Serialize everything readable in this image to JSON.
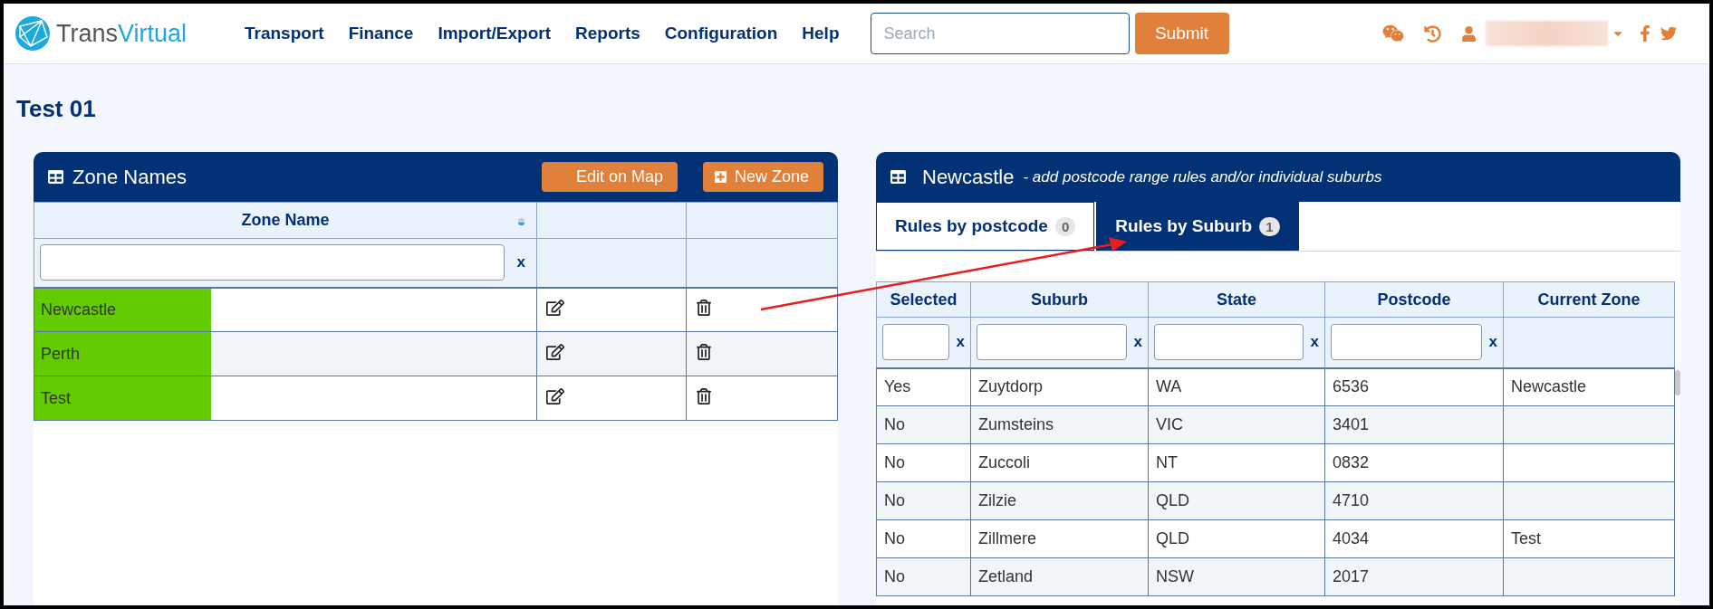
{
  "logo": {
    "brand_a": "Trans",
    "brand_b": "Virtual"
  },
  "nav": [
    "Transport",
    "Finance",
    "Import/Export",
    "Reports",
    "Configuration",
    "Help"
  ],
  "search": {
    "placeholder": "Search"
  },
  "submit": "Submit",
  "page_title": "Test 01",
  "zones_panel": {
    "title": "Zone Names",
    "buttons": [
      {
        "label": "Edit on Map",
        "kind": "plain"
      },
      {
        "label": "New Zone",
        "kind": "add"
      }
    ],
    "column": "Zone Name",
    "filter_clear": "x",
    "rows": [
      {
        "name": "Newcastle",
        "highlighted": true
      },
      {
        "name": "Perth",
        "highlighted": true
      },
      {
        "name": "Test",
        "highlighted": true
      }
    ]
  },
  "rules_panel": {
    "title": "Newcastle",
    "subtitle": "- add postcode range rules and/or individual suburbs",
    "tabs": [
      {
        "label": "Rules by postcode",
        "count": "0",
        "selected": false
      },
      {
        "label": "Rules by Suburb",
        "count": "1",
        "selected": true
      }
    ],
    "columns": [
      {
        "label": "Selected",
        "clear": "x"
      },
      {
        "label": "Suburb",
        "clear": "x"
      },
      {
        "label": "State",
        "clear": "x"
      },
      {
        "label": "Postcode",
        "clear": "x"
      },
      {
        "label": "Current Zone"
      }
    ],
    "rows": [
      {
        "selected": "Yes",
        "suburb": "Zuytdorp",
        "state": "WA",
        "postcode": "6536",
        "current_zone": "Newcastle"
      },
      {
        "selected": "No",
        "suburb": "Zumsteins",
        "state": "VIC",
        "postcode": "3401"
      },
      {
        "selected": "No",
        "suburb": "Zuccoli",
        "state": "NT",
        "postcode": "0832"
      },
      {
        "selected": "No",
        "suburb": "Zilzie",
        "state": "QLD",
        "postcode": "4710"
      },
      {
        "selected": "No",
        "suburb": "Zillmere",
        "state": "QLD",
        "postcode": "4034",
        "current_zone": "Test"
      },
      {
        "selected": "No",
        "suburb": "Zetland",
        "state": "NSW",
        "postcode": "2017"
      }
    ]
  }
}
